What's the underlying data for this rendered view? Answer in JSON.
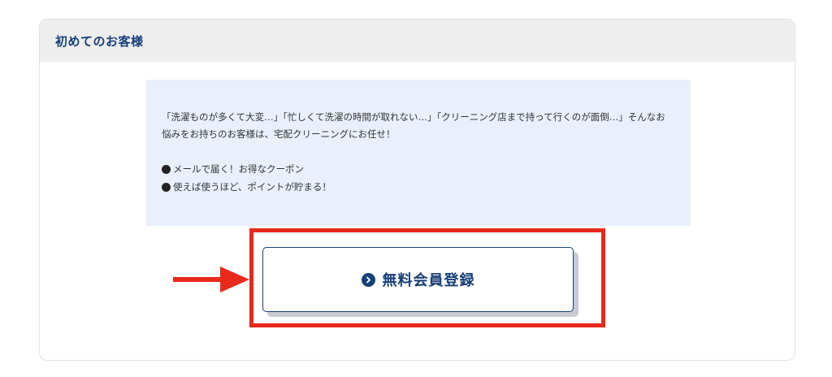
{
  "section": {
    "title": "初めてのお客様"
  },
  "info": {
    "paragraph": "「洗濯ものが多くて大変…」「忙しくて洗濯の時間が取れない…」「クリーニング店まで持って行くのが面倒…」そんなお悩みをお持ちのお客様は、宅配クリーニングにお任せ！",
    "bullets": [
      "メールで届く！お得なクーポン",
      "使えば使うほど、ポイントが貯まる！"
    ]
  },
  "cta": {
    "label": "無料会員登録",
    "icon": "chevron-right-circle-icon"
  },
  "annotation": {
    "arrow_icon": "arrow-right-icon",
    "highlight_color": "#e8291c"
  },
  "colors": {
    "brand": "#173f78",
    "info_bg": "#e9f0fc",
    "header_bg": "#eeeeee"
  }
}
